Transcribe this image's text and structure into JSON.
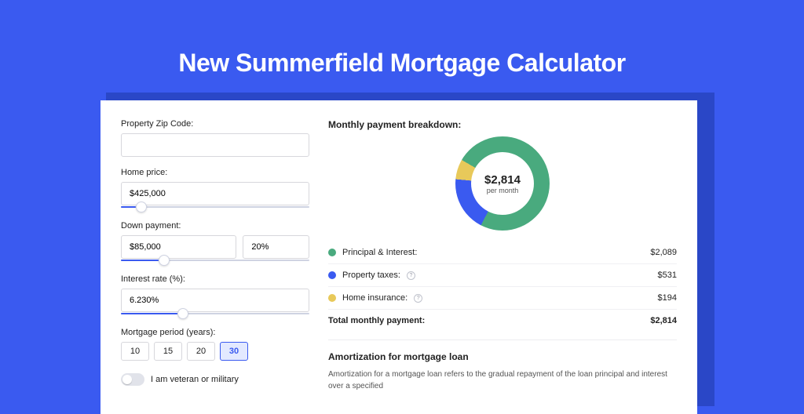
{
  "title": "New Summerfield Mortgage Calculator",
  "left": {
    "zip_label": "Property Zip Code:",
    "zip_value": "",
    "home_price_label": "Home price:",
    "home_price_value": "$425,000",
    "down_payment_label": "Down payment:",
    "down_payment_value": "$85,000",
    "down_payment_pct": "20%",
    "interest_label": "Interest rate (%):",
    "interest_value": "6.230%",
    "period_label": "Mortgage period (years):",
    "periods": [
      "10",
      "15",
      "20",
      "30"
    ],
    "period_selected": "30",
    "veteran_label": "I am veteran or military"
  },
  "right": {
    "breakdown_title": "Monthly payment breakdown:",
    "donut_amount": "$2,814",
    "donut_sub": "per month",
    "items": [
      {
        "label": "Principal & Interest:",
        "value": "$2,089",
        "color": "#49aa7e",
        "info": false
      },
      {
        "label": "Property taxes:",
        "value": "$531",
        "color": "#3a5af0",
        "info": true
      },
      {
        "label": "Home insurance:",
        "value": "$194",
        "color": "#e8c95a",
        "info": true
      }
    ],
    "total_label": "Total monthly payment:",
    "total_value": "$2,814",
    "amort_title": "Amortization for mortgage loan",
    "amort_text": "Amortization for a mortgage loan refers to the gradual repayment of the loan principal and interest over a specified"
  },
  "chart_data": {
    "type": "pie",
    "title": "Monthly payment breakdown",
    "series": [
      {
        "name": "Principal & Interest",
        "value": 2089,
        "color": "#49aa7e"
      },
      {
        "name": "Property taxes",
        "value": 531,
        "color": "#3a5af0"
      },
      {
        "name": "Home insurance",
        "value": 194,
        "color": "#e8c95a"
      }
    ],
    "total": 2814,
    "center_label": "$2,814 per month"
  }
}
